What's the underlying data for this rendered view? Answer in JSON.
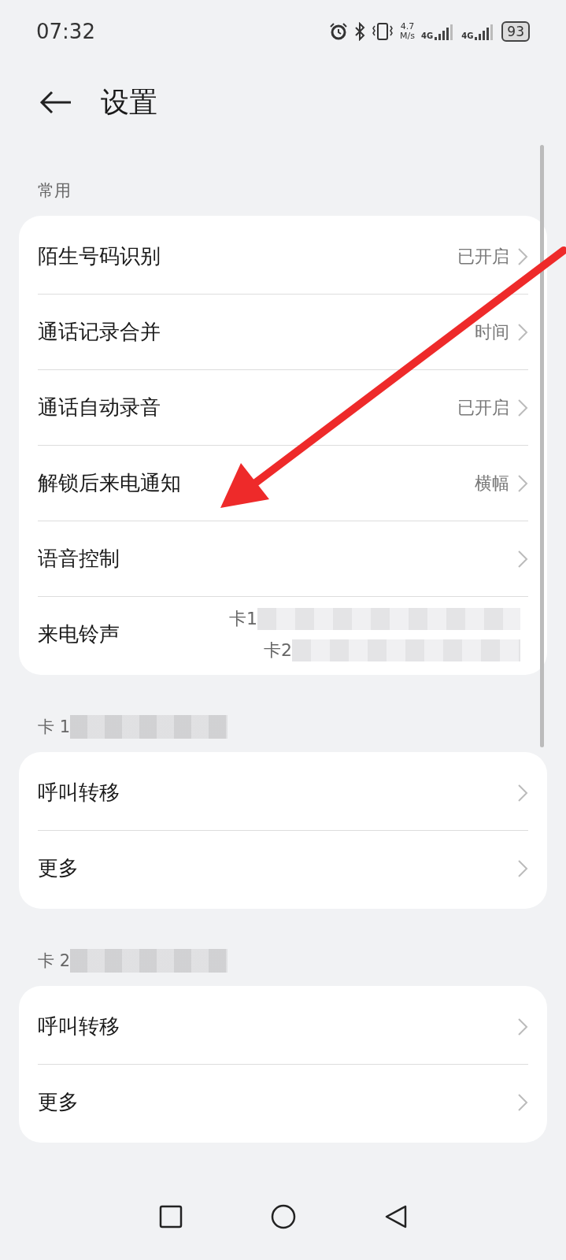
{
  "status_bar": {
    "time": "07:32",
    "speed": [
      "4.7",
      "M/s"
    ],
    "networks": [
      "4G",
      "4G"
    ],
    "battery": "93"
  },
  "header": {
    "title": "设置"
  },
  "sections": [
    {
      "title": "常用",
      "redacted": false,
      "rows": [
        {
          "kind": "value",
          "label": "陌生号码识别",
          "value": "已开启"
        },
        {
          "kind": "value",
          "label": "通话记录合并",
          "value": "时间"
        },
        {
          "kind": "value",
          "label": "通话自动录音",
          "value": "已开启"
        },
        {
          "kind": "value",
          "label": "解锁后来电通知",
          "value": "横幅"
        },
        {
          "kind": "value",
          "label": "语音控制"
        },
        {
          "kind": "ringtone",
          "label": "来电铃声",
          "lines": [
            "卡1",
            "卡2"
          ]
        }
      ]
    },
    {
      "title": "卡 1",
      "redacted": true,
      "rows": [
        {
          "kind": "value",
          "label": "呼叫转移"
        },
        {
          "kind": "value",
          "label": "更多"
        }
      ]
    },
    {
      "title": "卡 2",
      "redacted": true,
      "rows": [
        {
          "kind": "value",
          "label": "呼叫转移"
        },
        {
          "kind": "value",
          "label": "更多"
        }
      ]
    }
  ]
}
